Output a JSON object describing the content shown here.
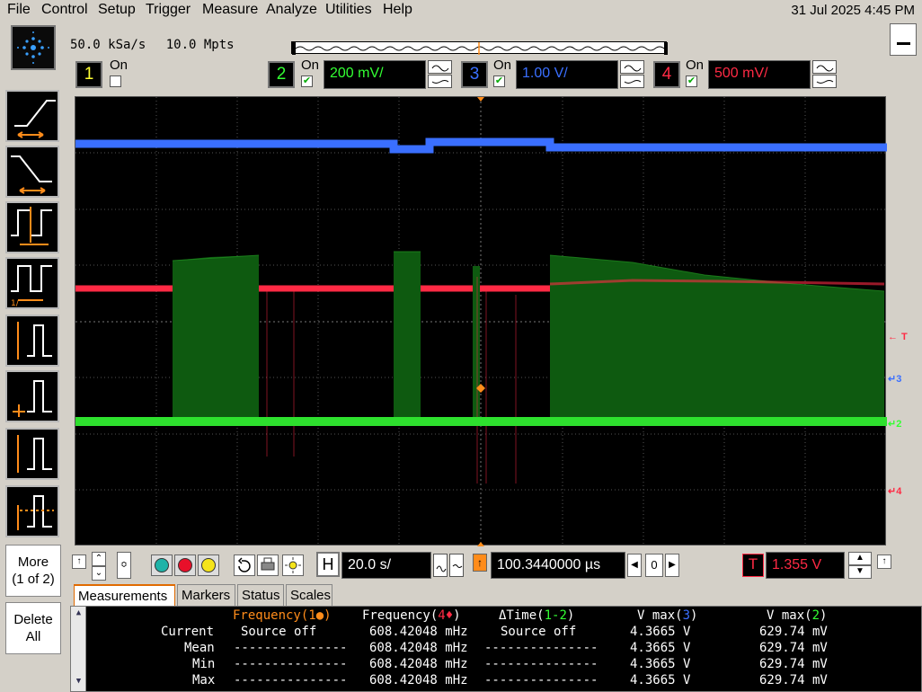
{
  "menu": [
    "File",
    "Control",
    "Setup",
    "Trigger",
    "Measure",
    "Analyze",
    "Utilities",
    "Help"
  ],
  "datetime": "31 Jul 2025  4:45 PM",
  "acquisition": {
    "sample_rate": "50.0 kSa/s",
    "memory": "10.0 Mpts"
  },
  "channels": [
    {
      "num": "1",
      "on_label": "On",
      "checked": false,
      "color": "#ffff33"
    },
    {
      "num": "2",
      "on_label": "On",
      "checked": true,
      "scale": "200 mV/",
      "color": "#33ff33"
    },
    {
      "num": "3",
      "on_label": "On",
      "checked": true,
      "scale": "1.00 V/",
      "color": "#3a6fff"
    },
    {
      "num": "4",
      "on_label": "On",
      "checked": true,
      "scale": "500 mV/",
      "color": "#ff2a44"
    }
  ],
  "side_buttons": {
    "more": "More",
    "more_page": "(1 of 2)",
    "delete": "Delete",
    "delete_all": "All"
  },
  "markers": {
    "trigger": "T",
    "ch3": "3",
    "ch2": "2",
    "ch4": "4"
  },
  "horizontal": {
    "label": "H",
    "timebase": "20.0 s/",
    "position": "100.3440000 µs",
    "ref": "0"
  },
  "trigger": {
    "label": "T",
    "level": "1.355 V"
  },
  "tabs": [
    "Measurements",
    "Markers",
    "Status",
    "Scales"
  ],
  "measurements": {
    "headers": [
      {
        "name": "Frequency",
        "ch": "1",
        "sym": "●",
        "color": "#ff8c1a"
      },
      {
        "name": "Frequency",
        "ch": "4",
        "sym": "♦",
        "color": "#ffffff"
      },
      {
        "name": "ΔTime",
        "ch": "1-2",
        "sym": "",
        "color": "#ffffff"
      },
      {
        "name": "V max",
        "ch": "3",
        "sym": "",
        "color": "#ffffff"
      },
      {
        "name": "V max",
        "ch": "2",
        "sym": "",
        "color": "#ffffff"
      }
    ],
    "rows": [
      {
        "label": "Current",
        "values": [
          "Source off",
          "608.42048 mHz",
          "Source off",
          "4.3665 V",
          "629.74 mV"
        ]
      },
      {
        "label": "Mean",
        "values": [
          "---------------",
          "608.42048 mHz",
          "---------------",
          "4.3665 V",
          "629.74 mV"
        ]
      },
      {
        "label": "Min",
        "values": [
          "---------------",
          "608.42048 mHz",
          "---------------",
          "4.3665 V",
          "629.74 mV"
        ]
      },
      {
        "label": "Max",
        "values": [
          "---------------",
          "608.42048 mHz",
          "---------------",
          "4.3665 V",
          "629.74 mV"
        ]
      }
    ]
  }
}
